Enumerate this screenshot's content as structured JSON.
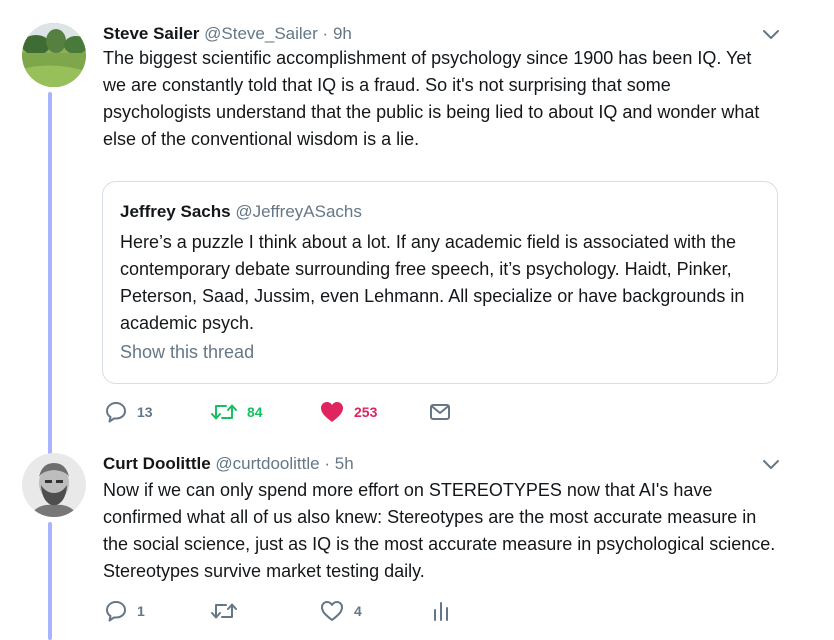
{
  "tweet1": {
    "name": "Steve Sailer",
    "handle": "@Steve_Sailer",
    "sep": "·",
    "time": "9h",
    "text": "The biggest scientific accomplishment of psychology since 1900 has been IQ. Yet we are constantly told that IQ is a fraud. So it's not surprising that some psychologists understand that the public is being lied to about IQ and wonder what else of the conventional wisdom is a lie.",
    "quote": {
      "name": "Jeffrey Sachs",
      "handle": "@JeffreyASachs",
      "text": "Here’s a puzzle I think about a lot. If any academic field is associated with the contemporary debate surrounding free speech, it’s psychology. Haidt, Pinker, Peterson, Saad, Jussim, even Lehmann. All specialize or have backgrounds in academic psych.",
      "show_thread": "Show this thread"
    },
    "actions": {
      "replies": "13",
      "retweets": "84",
      "likes": "253"
    }
  },
  "tweet2": {
    "name": "Curt Doolittle",
    "handle": "@curtdoolittle",
    "sep": "·",
    "time": "5h",
    "text": "Now if we can only spend more effort on STEREOTYPES now that AI's have confirmed what all of us also knew: Stereotypes are the most accurate measure in the social science, just as IQ is the most accurate measure in psychological science. Stereotypes survive market testing daily.",
    "actions": {
      "replies": "1",
      "retweets": "",
      "likes": "4"
    }
  },
  "colors": {
    "thread_line": "#a8b4ff",
    "retweet_green": "#17bf63",
    "like_red": "#e0245e",
    "icon_gray": "#657786"
  }
}
